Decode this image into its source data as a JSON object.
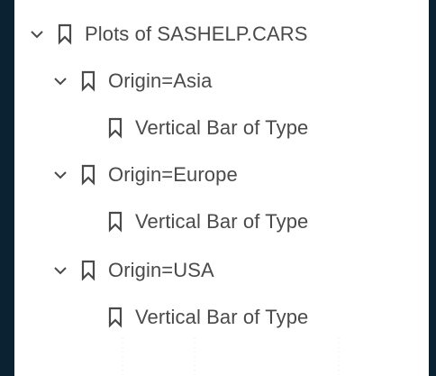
{
  "tree": {
    "root": {
      "label": "Plots of SASHELP.CARS",
      "icon": "bookmark-icon",
      "expanded": true
    },
    "groups": [
      {
        "label": "Origin=Asia",
        "icon": "bookmark-icon",
        "expanded": true,
        "children": [
          {
            "label": "Vertical Bar of Type",
            "icon": "bookmark-icon"
          }
        ]
      },
      {
        "label": "Origin=Europe",
        "icon": "bookmark-icon",
        "expanded": true,
        "children": [
          {
            "label": "Vertical Bar of Type",
            "icon": "bookmark-icon"
          }
        ]
      },
      {
        "label": "Origin=USA",
        "icon": "bookmark-icon",
        "expanded": true,
        "children": [
          {
            "label": "Vertical Bar of Type",
            "icon": "bookmark-icon"
          }
        ]
      }
    ]
  },
  "colors": {
    "background": "#0b2233",
    "panel": "#ffffff",
    "text": "#4a4a4a",
    "icon": "#4a4a4a"
  }
}
